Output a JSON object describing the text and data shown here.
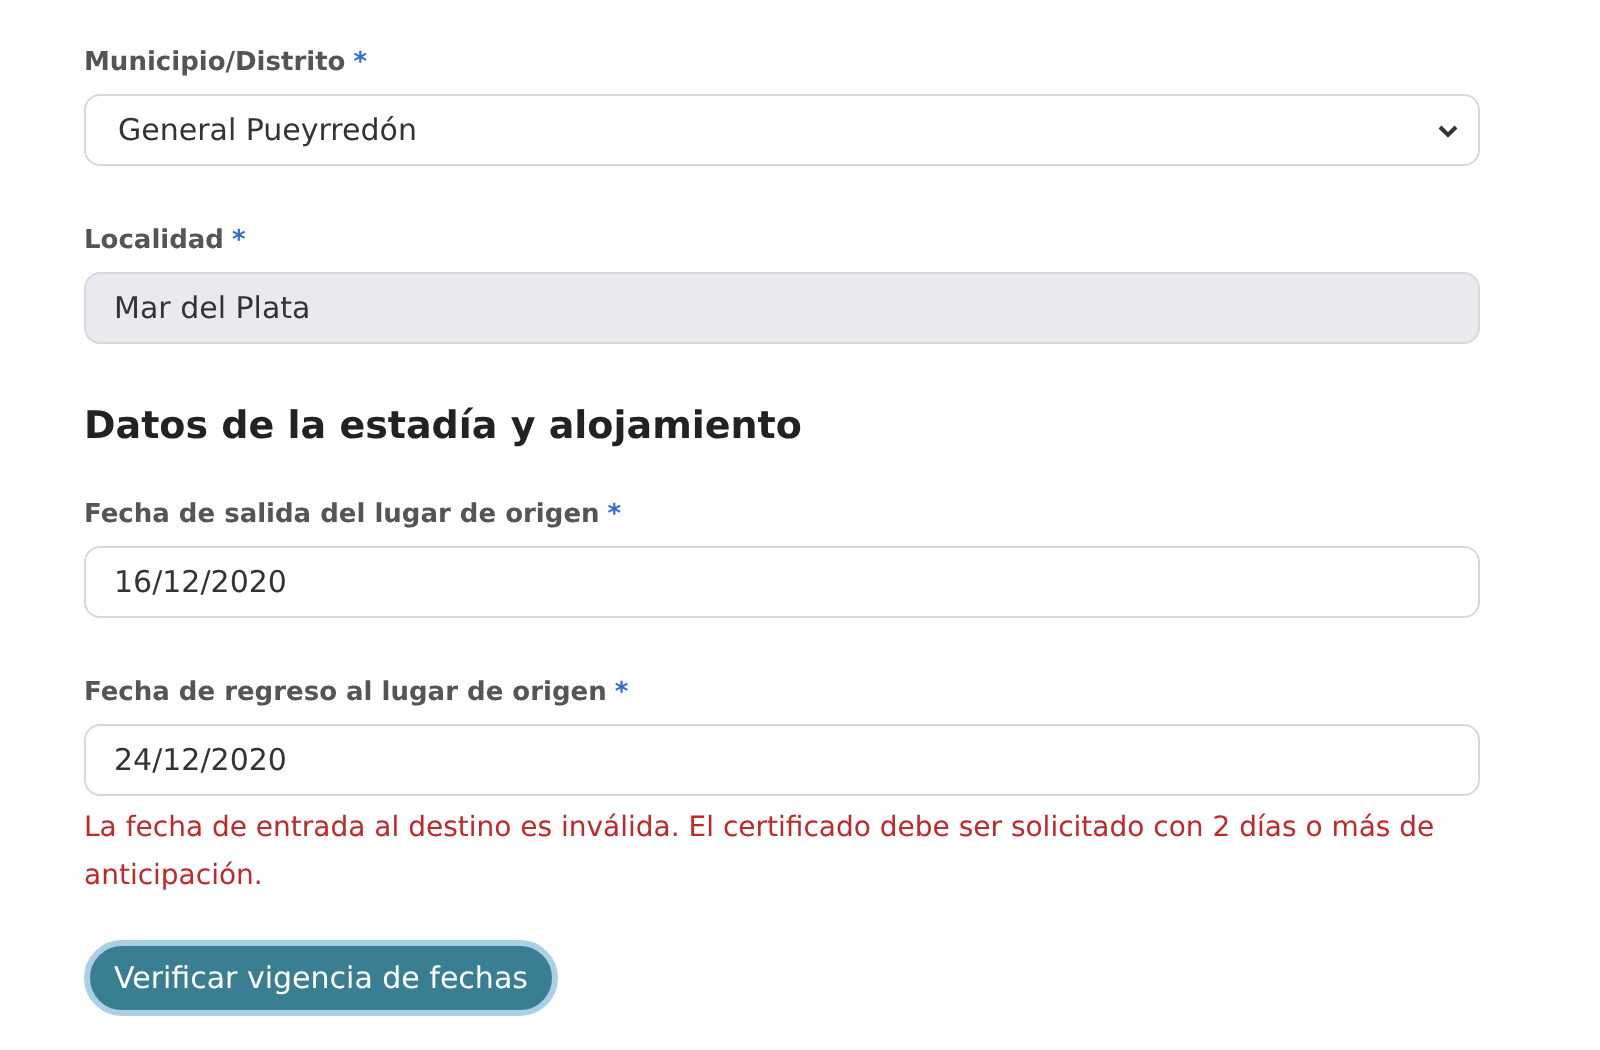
{
  "fields_location": [
    {
      "label": "Municipio/Distrito",
      "required_mark": "*",
      "kind": "select",
      "value": "General Pueyrredón"
    },
    {
      "label": "Localidad",
      "required_mark": "*",
      "kind": "readonly",
      "value": "Mar del Plata"
    }
  ],
  "section_title": "Datos de la estadía y alojamiento",
  "fields_stay": [
    {
      "label": "Fecha de salida del lugar de origen",
      "required_mark": "*",
      "kind": "text",
      "value": "16/12/2020"
    },
    {
      "label": "Fecha de regreso al lugar de origen",
      "required_mark": "*",
      "kind": "text",
      "value": "24/12/2020",
      "error": "La fecha de entrada al destino es inválida. El certificado debe ser solicitado con 2 días o más de anticipación."
    }
  ],
  "button": {
    "label": "Verificar vigencia de fechas"
  }
}
